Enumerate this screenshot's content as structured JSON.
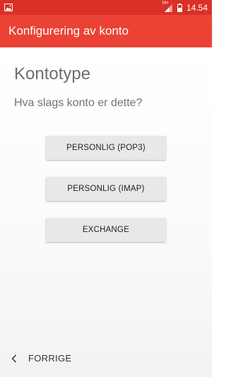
{
  "status_bar": {
    "time": "14.54",
    "network_type": "H+",
    "icons": [
      "image-notification-icon",
      "signal-icon",
      "battery-icon"
    ]
  },
  "app_bar": {
    "title": "Konfigurering av konto",
    "color": "#ea4335"
  },
  "main": {
    "heading": "Kontotype",
    "question": "Hva slags konto er dette?",
    "options": [
      {
        "label": "PERSONLIG (POP3)"
      },
      {
        "label": "PERSONLIG (IMAP)"
      },
      {
        "label": "EXCHANGE"
      }
    ]
  },
  "bottom_nav": {
    "back_label": "FORRIGE",
    "back_icon": "chevron-left-icon"
  }
}
